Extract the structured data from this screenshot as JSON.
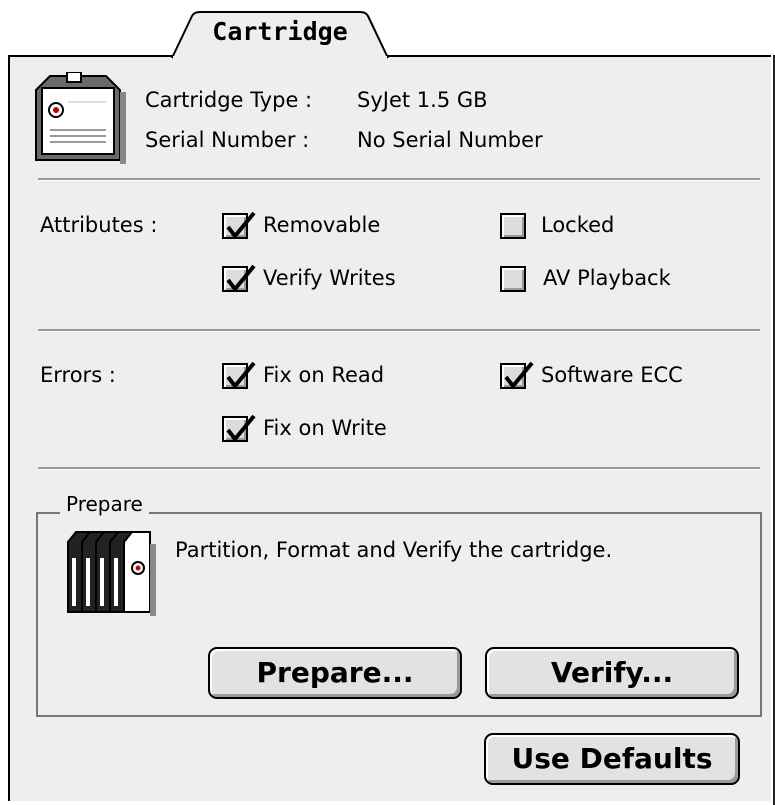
{
  "tab": {
    "label": "Cartridge"
  },
  "info": {
    "type_label": "Cartridge Type :",
    "type_value": "SyJet 1.5 GB",
    "serial_label": "Serial Number :",
    "serial_value": "No Serial Number"
  },
  "attributes": {
    "label": "Attributes :",
    "removable": {
      "label": "Removable",
      "checked": true
    },
    "verify_writes": {
      "label": "Verify Writes",
      "checked": true
    },
    "locked": {
      "label": "Locked",
      "checked": false
    },
    "av_playback": {
      "label": "AV Playback",
      "checked": false
    }
  },
  "errors": {
    "label": "Errors :",
    "fix_on_read": {
      "label": "Fix on Read",
      "checked": true
    },
    "fix_on_write": {
      "label": "Fix on Write",
      "checked": true
    },
    "software_ecc": {
      "label": "Software ECC",
      "checked": true
    }
  },
  "prepare": {
    "title": "Prepare",
    "description": "Partition, Format and Verify the cartridge.",
    "prepare_button": "Prepare...",
    "verify_button": "Verify..."
  },
  "use_defaults_button": "Use Defaults",
  "colors": {
    "panel": "#eeeeee",
    "check": "#000000"
  }
}
